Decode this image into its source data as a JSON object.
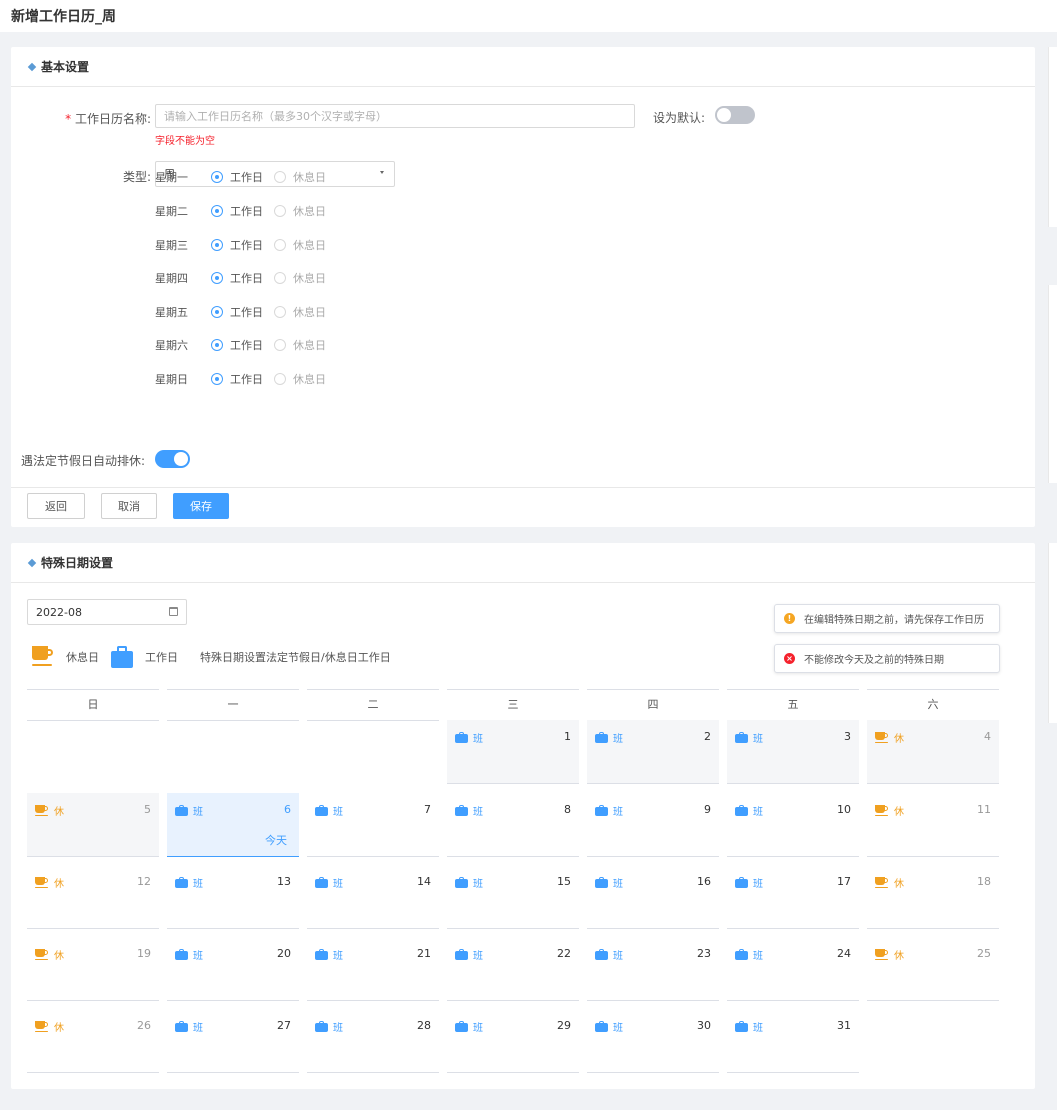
{
  "page": {
    "title": "新增工作日历_周"
  },
  "basic": {
    "section_title": "基本设置",
    "name_label": "工作日历名称:",
    "name_placeholder": "请输入工作日历名称（最多30个汉字或字母）",
    "name_error": "字段不能为空",
    "default_label": "设为默认:",
    "default_on": false,
    "type_label": "类型:",
    "type_value": "周",
    "workday_label": "工作日",
    "restday_label": "休息日",
    "days": [
      {
        "name": "星期一",
        "selected": "工作日"
      },
      {
        "name": "星期二",
        "selected": "工作日"
      },
      {
        "name": "星期三",
        "selected": "工作日"
      },
      {
        "name": "星期四",
        "selected": "工作日"
      },
      {
        "name": "星期五",
        "selected": "工作日"
      },
      {
        "name": "星期六",
        "selected": "工作日"
      },
      {
        "name": "星期日",
        "selected": "工作日"
      }
    ],
    "holiday_label": "遇法定节假日自动排休:",
    "holiday_on": true,
    "buttons": {
      "back": "返回",
      "cancel": "取消",
      "save": "保存"
    }
  },
  "special": {
    "section_title": "特殊日期设置",
    "month": "2022-08",
    "legend": {
      "rest": "休息日",
      "work": "工作日",
      "desc": "特殊日期设置法定节假日/休息日工作日"
    },
    "alerts": [
      {
        "type": "warning",
        "text": "在编辑特殊日期之前，请先保存工作日历"
      },
      {
        "type": "error",
        "text": "不能修改今天及之前的特殊日期"
      }
    ],
    "weekdays": [
      "日",
      "一",
      "二",
      "三",
      "四",
      "五",
      "六"
    ],
    "tags": {
      "rest": "休",
      "work": "班"
    },
    "today_label": "今天",
    "weeks": [
      [
        null,
        null,
        null,
        {
          "d": "1",
          "t": "work"
        },
        {
          "d": "2",
          "t": "work"
        },
        {
          "d": "3",
          "t": "work"
        },
        {
          "d": "4",
          "t": "rest"
        }
      ],
      [
        {
          "d": "5",
          "t": "rest"
        },
        {
          "d": "6",
          "t": "work",
          "today": true
        },
        {
          "d": "7",
          "t": "work"
        },
        {
          "d": "8",
          "t": "work"
        },
        {
          "d": "9",
          "t": "work"
        },
        {
          "d": "10",
          "t": "work"
        },
        {
          "d": "11",
          "t": "rest"
        }
      ],
      [
        {
          "d": "12",
          "t": "rest"
        },
        {
          "d": "13",
          "t": "work"
        },
        {
          "d": "14",
          "t": "work"
        },
        {
          "d": "15",
          "t": "work"
        },
        {
          "d": "16",
          "t": "work"
        },
        {
          "d": "17",
          "t": "work"
        },
        {
          "d": "18",
          "t": "rest"
        }
      ],
      [
        {
          "d": "19",
          "t": "rest"
        },
        {
          "d": "20",
          "t": "work"
        },
        {
          "d": "21",
          "t": "work"
        },
        {
          "d": "22",
          "t": "work"
        },
        {
          "d": "23",
          "t": "work"
        },
        {
          "d": "24",
          "t": "work"
        },
        {
          "d": "25",
          "t": "rest"
        }
      ],
      [
        {
          "d": "26",
          "t": "rest"
        },
        {
          "d": "27",
          "t": "work"
        },
        {
          "d": "28",
          "t": "work"
        },
        {
          "d": "29",
          "t": "work"
        },
        {
          "d": "30",
          "t": "work"
        },
        {
          "d": "31",
          "t": "work"
        },
        null
      ]
    ]
  },
  "colors": {
    "primary": "#409eff",
    "rest": "#f0a020",
    "error": "#f5222d",
    "warning": "#f5a623"
  }
}
